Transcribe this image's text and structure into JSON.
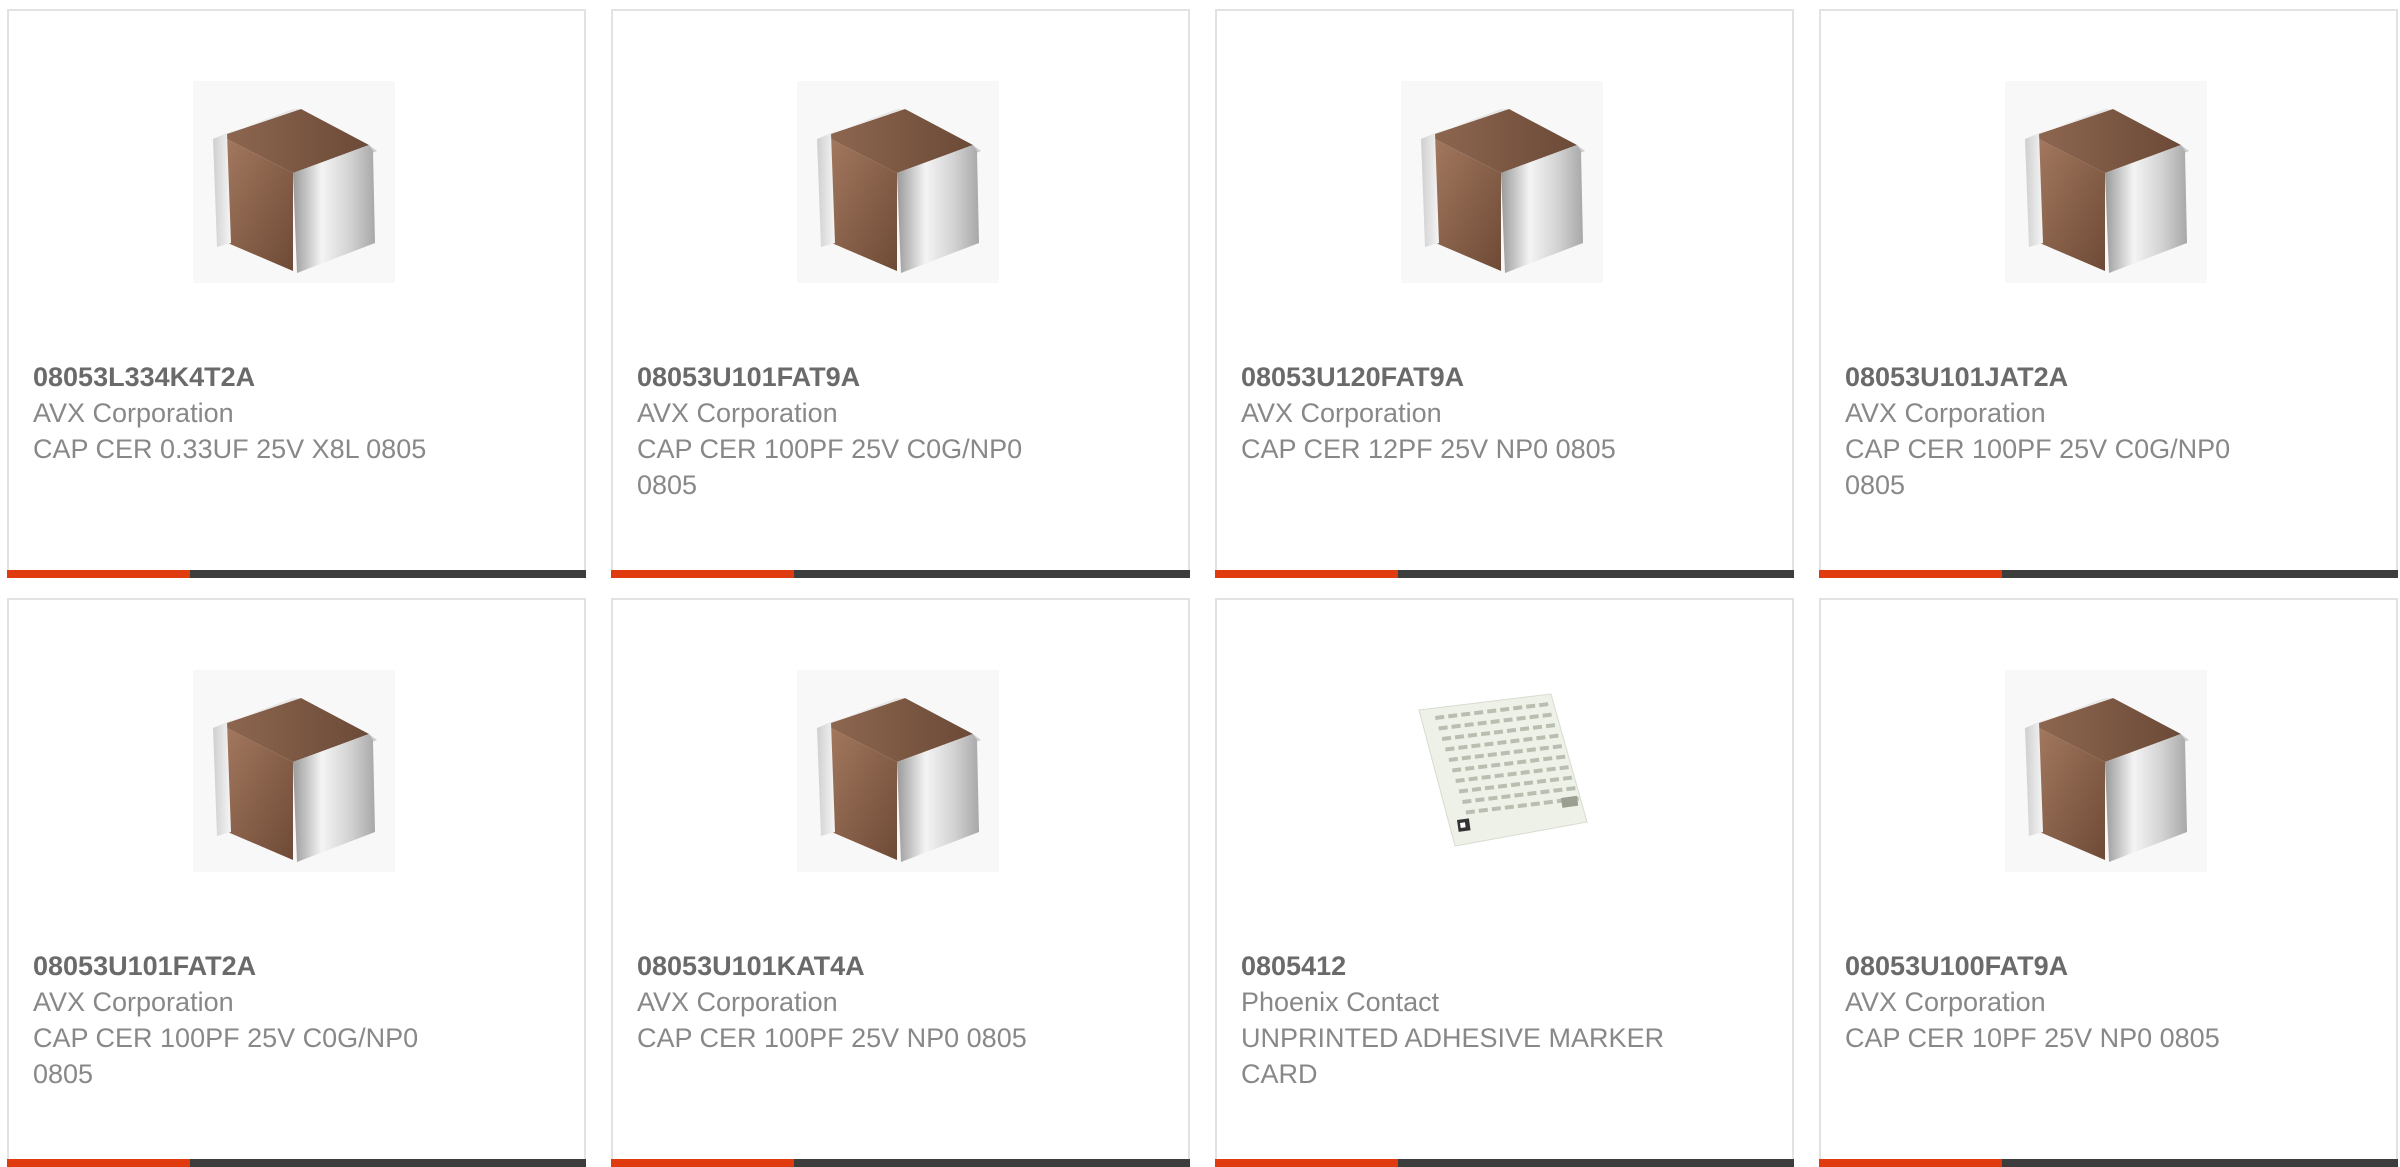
{
  "colors": {
    "accent": "#e03b0e",
    "bar": "#3d3d3d",
    "border": "#e2e2e2",
    "text": "#888888",
    "part_text": "#6a6a6a"
  },
  "products": [
    {
      "part": "08053L334K4T2A",
      "manufacturer": "AVX Corporation",
      "description": "CAP CER 0.33UF 25V X8L 0805",
      "image_icon": "ceramic-capacitor-icon"
    },
    {
      "part": "08053U101FAT9A",
      "manufacturer": "AVX Corporation",
      "description": "CAP CER 100PF 25V C0G/NP0 0805",
      "image_icon": "ceramic-capacitor-icon"
    },
    {
      "part": "08053U120FAT9A",
      "manufacturer": "AVX Corporation",
      "description": "CAP CER 12PF 25V NP0 0805",
      "image_icon": "ceramic-capacitor-icon"
    },
    {
      "part": "08053U101JAT2A",
      "manufacturer": "AVX Corporation",
      "description": "CAP CER 100PF 25V C0G/NP0 0805",
      "image_icon": "ceramic-capacitor-icon"
    },
    {
      "part": "08053U101FAT2A",
      "manufacturer": "AVX Corporation",
      "description": "CAP CER 100PF 25V C0G/NP0 0805",
      "image_icon": "ceramic-capacitor-icon"
    },
    {
      "part": "08053U101KAT4A",
      "manufacturer": "AVX Corporation",
      "description": "CAP CER 100PF 25V NP0 0805",
      "image_icon": "ceramic-capacitor-icon"
    },
    {
      "part": "0805412",
      "manufacturer": "Phoenix Contact",
      "description": "UNPRINTED ADHESIVE MARKER CARD",
      "image_icon": "marker-card-icon"
    },
    {
      "part": "08053U100FAT9A",
      "manufacturer": "AVX Corporation",
      "description": "CAP CER 10PF 25V NP0 0805",
      "image_icon": "ceramic-capacitor-icon"
    }
  ]
}
